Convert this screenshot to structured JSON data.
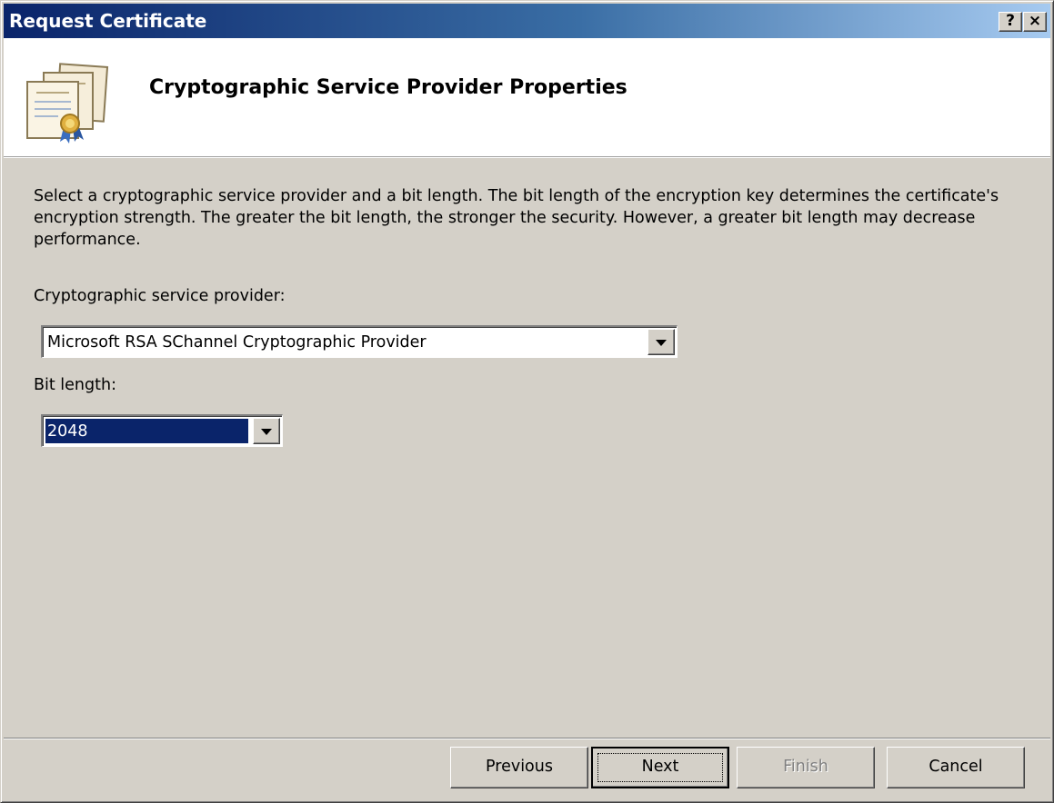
{
  "window": {
    "title": "Request Certificate",
    "help_button": "?",
    "close_button": "×"
  },
  "header": {
    "title": "Cryptographic Service Provider Properties",
    "icon": "certificate-icon"
  },
  "body": {
    "description": "Select a cryptographic service provider and a bit length. The bit length of the encryption key determines the certificate's encryption strength. The greater the bit length, the stronger the security. However, a greater bit length may decrease performance.",
    "csp_label": "Cryptographic service provider:",
    "csp_value": "Microsoft RSA SChannel Cryptographic Provider",
    "bit_label": "Bit length:",
    "bit_value": "2048"
  },
  "buttons": {
    "previous": "Previous",
    "next": "Next",
    "finish": "Finish",
    "cancel": "Cancel"
  },
  "colors": {
    "titlebar_start": "#0a246a",
    "titlebar_end": "#a6caf0",
    "dialog_face": "#d4d0c8",
    "selection": "#0a246a"
  }
}
